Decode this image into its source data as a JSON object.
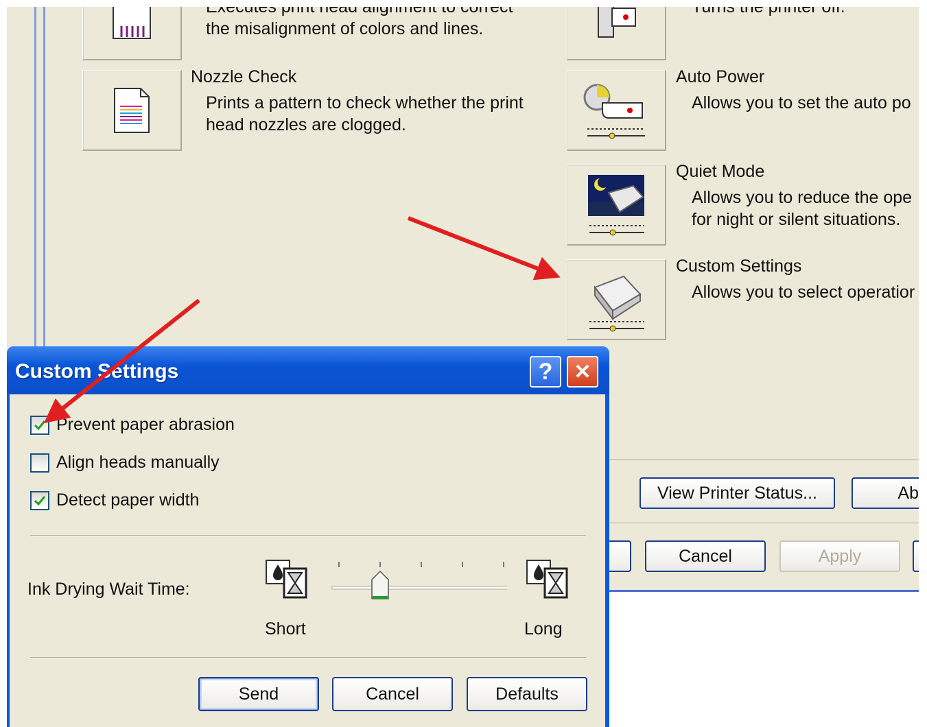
{
  "background_window": {
    "items": [
      {
        "title": "",
        "desc": "Executes print head alignment to correct\nthe misalignment of colors and lines."
      },
      {
        "title": "Nozzle Check",
        "desc": "Prints a pattern to check whether the print\nhead nozzles are clogged."
      },
      {
        "title": "",
        "desc": "Turns the printer off."
      },
      {
        "title": "Auto Power",
        "desc": "Allows you to set the auto po"
      },
      {
        "title": "Quiet Mode",
        "desc": "Allows you to reduce the ope\nfor night or silent situations."
      },
      {
        "title": "Custom Settings",
        "desc": "Allows you to select operatior"
      }
    ],
    "buttons": {
      "view_status": "View Printer Status...",
      "about": "Ab",
      "cancel": "Cancel",
      "apply": "Apply"
    }
  },
  "dialog": {
    "title": "Custom Settings",
    "help_label": "?",
    "close_label": "✕",
    "checkboxes": [
      {
        "label": "Prevent paper abrasion",
        "checked": true
      },
      {
        "label": "Align heads manually",
        "checked": false
      },
      {
        "label": "Detect paper width",
        "checked": true
      }
    ],
    "ink_drying": {
      "label": "Ink Drying Wait Time:",
      "min_label": "Short",
      "max_label": "Long",
      "ticks": 5,
      "value_step": 1
    },
    "buttons": {
      "send": "Send",
      "cancel": "Cancel",
      "defaults": "Defaults"
    }
  },
  "colors": {
    "arrow": "#e02020",
    "xp_blue": "#0a5bdc",
    "face": "#ece9d8"
  }
}
